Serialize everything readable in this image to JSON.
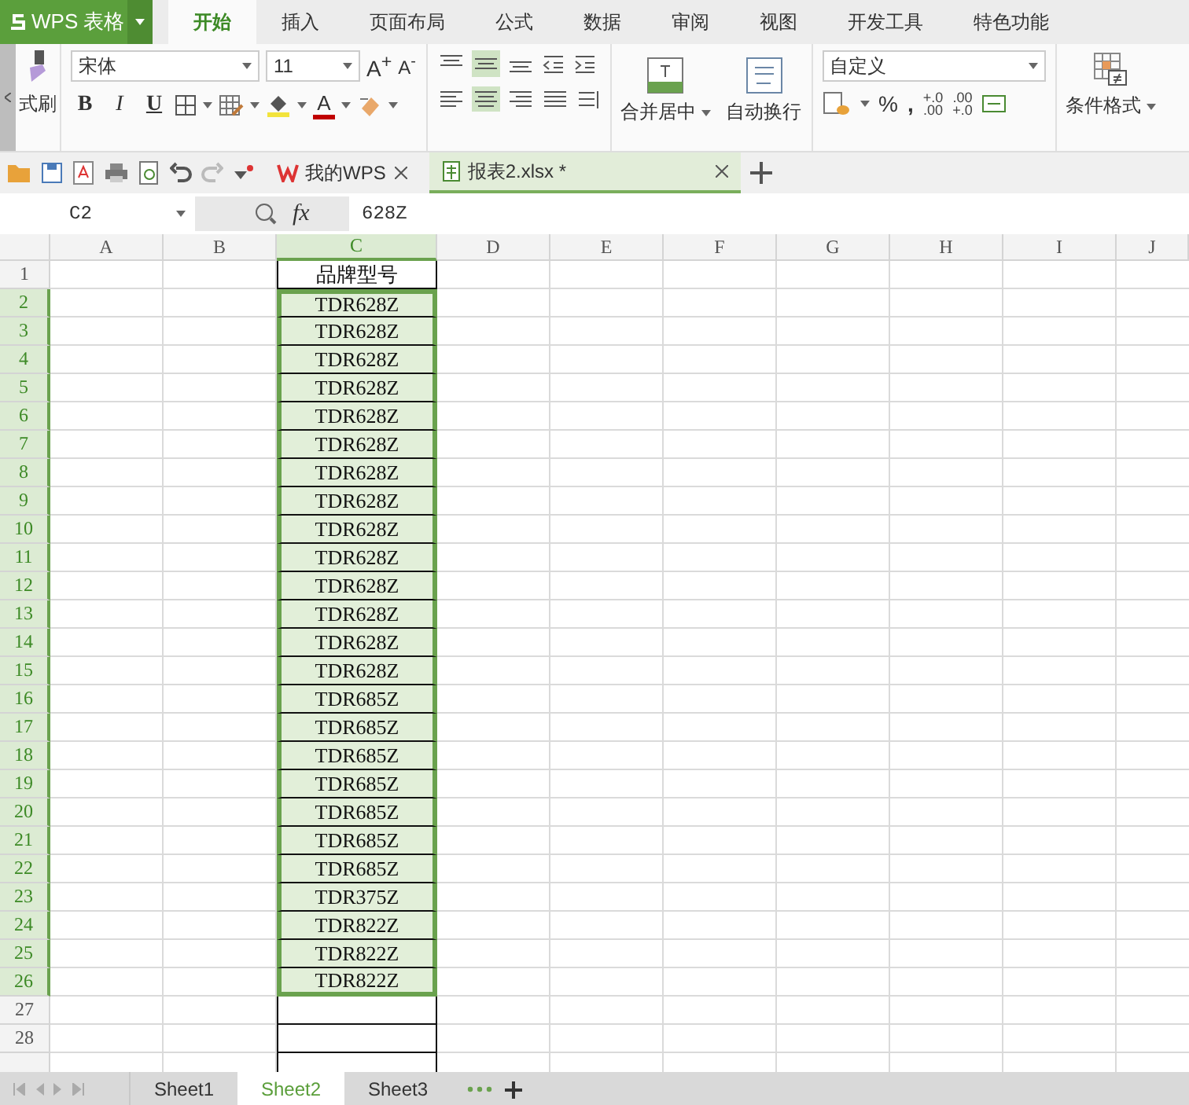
{
  "app": {
    "name": "WPS 表格"
  },
  "ribbon_tabs": [
    {
      "label": "开始",
      "selected": true
    },
    {
      "label": "插入",
      "selected": false
    },
    {
      "label": "页面布局",
      "selected": false
    },
    {
      "label": "公式",
      "selected": false
    },
    {
      "label": "数据",
      "selected": false
    },
    {
      "label": "审阅",
      "selected": false
    },
    {
      "label": "视图",
      "selected": false
    },
    {
      "label": "开发工具",
      "selected": false
    },
    {
      "label": "特色功能",
      "selected": false
    }
  ],
  "ribbon": {
    "painter_label": "式刷",
    "font_name": "宋体",
    "font_size": "11",
    "grow_font": "A$^{+}$",
    "shrink_font": "A$^{-}$",
    "bold": "B",
    "italic": "I",
    "underline": "U",
    "font_color": "A",
    "align_vertical": [
      {
        "kind": "top",
        "selected": false
      },
      {
        "kind": "middle",
        "selected": true
      },
      {
        "kind": "bottom",
        "selected": false
      }
    ],
    "align_horizontal": [
      {
        "kind": "left",
        "selected": false
      },
      {
        "kind": "center",
        "selected": true
      },
      {
        "kind": "right",
        "selected": false
      },
      {
        "kind": "justify",
        "selected": false
      }
    ],
    "merge_label": "合并居中",
    "wrap_label": "自动换行",
    "number_format": "自定义",
    "percent": "%",
    "comma": ",",
    "add_decimal": {
      "top": "+.0",
      "bottom": ".00"
    },
    "remove_decimal": {
      "top": ".00",
      "bottom": "+.0"
    },
    "conditional_label": "条件格式"
  },
  "doc_tabs": [
    {
      "label": "我的WPS",
      "selected": false
    },
    {
      "label": "报表2.xlsx *",
      "selected": true
    }
  ],
  "formula_bar": {
    "name_box": "C2",
    "fx": "fx",
    "value": "628Z"
  },
  "columns": [
    {
      "label": "A",
      "selected": false
    },
    {
      "label": "B",
      "selected": false
    },
    {
      "label": "C",
      "selected": true
    },
    {
      "label": "D",
      "selected": false
    },
    {
      "label": "E",
      "selected": false
    },
    {
      "label": "F",
      "selected": false
    },
    {
      "label": "G",
      "selected": false
    },
    {
      "label": "H",
      "selected": false
    },
    {
      "label": "I",
      "selected": false
    },
    {
      "label": "J",
      "selected": false
    }
  ],
  "rows": [
    {
      "number": "1",
      "c": "品牌型号",
      "selected": false
    },
    {
      "number": "2",
      "c": "TDR628Z",
      "selected": true
    },
    {
      "number": "3",
      "c": "TDR628Z",
      "selected": true
    },
    {
      "number": "4",
      "c": "TDR628Z",
      "selected": true
    },
    {
      "number": "5",
      "c": "TDR628Z",
      "selected": true
    },
    {
      "number": "6",
      "c": "TDR628Z",
      "selected": true
    },
    {
      "number": "7",
      "c": "TDR628Z",
      "selected": true
    },
    {
      "number": "8",
      "c": "TDR628Z",
      "selected": true
    },
    {
      "number": "9",
      "c": "TDR628Z",
      "selected": true
    },
    {
      "number": "10",
      "c": "TDR628Z",
      "selected": true
    },
    {
      "number": "11",
      "c": "TDR628Z",
      "selected": true
    },
    {
      "number": "12",
      "c": "TDR628Z",
      "selected": true
    },
    {
      "number": "13",
      "c": "TDR628Z",
      "selected": true
    },
    {
      "number": "14",
      "c": "TDR628Z",
      "selected": true
    },
    {
      "number": "15",
      "c": "TDR628Z",
      "selected": true
    },
    {
      "number": "16",
      "c": "TDR685Z",
      "selected": true
    },
    {
      "number": "17",
      "c": "TDR685Z",
      "selected": true
    },
    {
      "number": "18",
      "c": "TDR685Z",
      "selected": true
    },
    {
      "number": "19",
      "c": "TDR685Z",
      "selected": true
    },
    {
      "number": "20",
      "c": "TDR685Z",
      "selected": true
    },
    {
      "number": "21",
      "c": "TDR685Z",
      "selected": true
    },
    {
      "number": "22",
      "c": "TDR685Z",
      "selected": true
    },
    {
      "number": "23",
      "c": "TDR375Z",
      "selected": true
    },
    {
      "number": "24",
      "c": "TDR822Z",
      "selected": true
    },
    {
      "number": "25",
      "c": "TDR822Z",
      "selected": true
    },
    {
      "number": "26",
      "c": "TDR822Z",
      "selected": true
    },
    {
      "number": "27",
      "selected": false
    },
    {
      "number": "28",
      "selected": false
    }
  ],
  "sheet_tabs": [
    {
      "label": "Sheet1",
      "selected": false
    },
    {
      "label": "Sheet2",
      "selected": true
    },
    {
      "label": "Sheet3",
      "selected": false
    }
  ]
}
